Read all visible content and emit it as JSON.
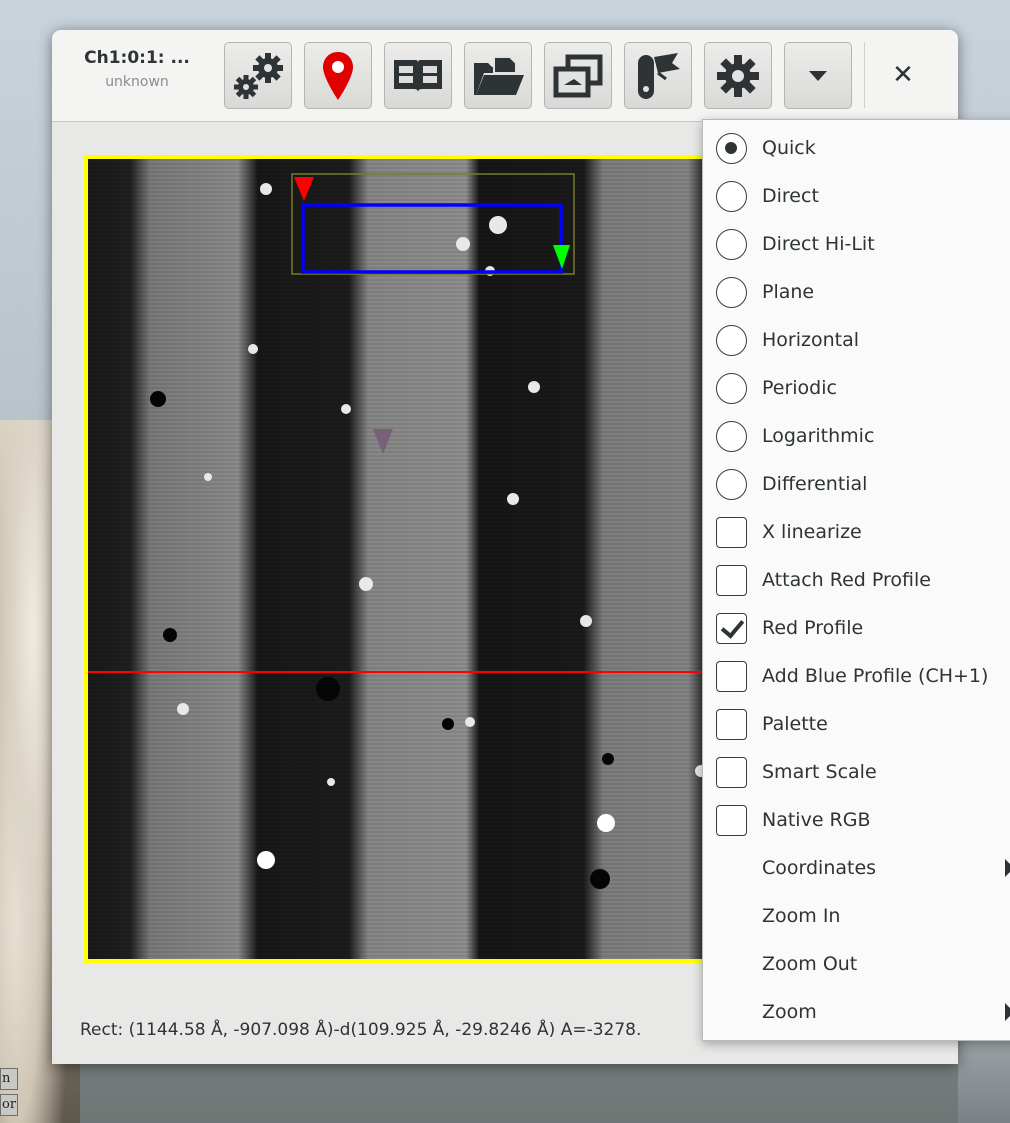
{
  "window": {
    "title": "Ch1:0:1: ...",
    "subtitle": "unknown"
  },
  "toolbar": {
    "buttons": [
      {
        "icon": "gears-icon"
      },
      {
        "icon": "map-pin-icon"
      },
      {
        "icon": "open-book-icon"
      },
      {
        "icon": "open-folder-icon"
      },
      {
        "icon": "windows-icon"
      },
      {
        "icon": "pen-tool-icon"
      },
      {
        "icon": "gear-icon"
      },
      {
        "icon": "dropdown-arrow-icon"
      }
    ],
    "close_label": "✕"
  },
  "status_text": "Rect: (1144.58 Å, -907.098 Å)-d(109.925 Å, -29.8246 Å) A=-3278.",
  "menu": {
    "items": [
      {
        "label": "Quick",
        "kind": "radio",
        "checked": true
      },
      {
        "label": "Direct",
        "kind": "radio",
        "checked": false
      },
      {
        "label": "Direct Hi-Lit",
        "kind": "radio",
        "checked": false
      },
      {
        "label": "Plane",
        "kind": "radio",
        "checked": false
      },
      {
        "label": "Horizontal",
        "kind": "radio",
        "checked": false
      },
      {
        "label": "Periodic",
        "kind": "radio",
        "checked": false
      },
      {
        "label": "Logarithmic",
        "kind": "radio",
        "checked": false
      },
      {
        "label": "Differential",
        "kind": "radio",
        "checked": false
      },
      {
        "label": "X linearize",
        "kind": "check",
        "checked": false
      },
      {
        "label": "Attach Red Profile",
        "kind": "check",
        "checked": false
      },
      {
        "label": "Red Profile",
        "kind": "check",
        "checked": true
      },
      {
        "label": "Add Blue Profile (CH+1)",
        "kind": "check",
        "checked": false
      },
      {
        "label": "Palette",
        "kind": "check",
        "checked": false
      },
      {
        "label": "Smart Scale",
        "kind": "check",
        "checked": false
      },
      {
        "label": "Native RGB",
        "kind": "check",
        "checked": false
      },
      {
        "label": "Coordinates",
        "kind": "submenu"
      },
      {
        "label": "Zoom In",
        "kind": "plain"
      },
      {
        "label": "Zoom Out",
        "kind": "plain"
      },
      {
        "label": "Zoom",
        "kind": "submenu"
      }
    ]
  },
  "desktop": {
    "labels": [
      "n",
      "or"
    ]
  },
  "colors": {
    "frame_border": "#ffff00",
    "selection_rect": "#0000ff",
    "profile_line": "#ff0000",
    "marker_red": "#ff0000",
    "marker_green": "#00ff00",
    "marker_purple": "#7a5f78"
  }
}
